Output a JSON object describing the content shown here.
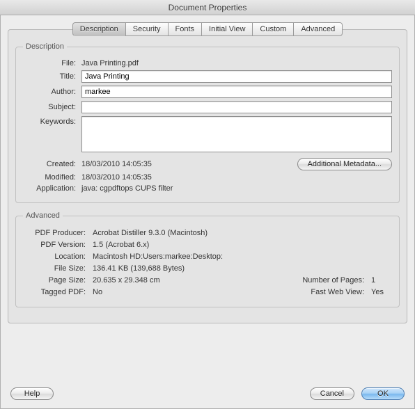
{
  "window": {
    "title": "Document Properties"
  },
  "tabs": {
    "description": "Description",
    "security": "Security",
    "fonts": "Fonts",
    "initial_view": "Initial View",
    "custom": "Custom",
    "advanced": "Advanced"
  },
  "description": {
    "legend": "Description",
    "labels": {
      "file": "File:",
      "title": "Title:",
      "author": "Author:",
      "subject": "Subject:",
      "keywords": "Keywords:",
      "created": "Created:",
      "modified": "Modified:",
      "application": "Application:"
    },
    "values": {
      "file": "Java Printing.pdf",
      "title": "Java Printing",
      "author": "markee",
      "subject": "",
      "keywords": "",
      "created": "18/03/2010 14:05:35",
      "modified": "18/03/2010 14:05:35",
      "application": "java: cgpdftops CUPS filter"
    },
    "additional_metadata_btn": "Additional Metadata..."
  },
  "advanced": {
    "legend": "Advanced",
    "labels": {
      "pdf_producer": "PDF Producer:",
      "pdf_version": "PDF Version:",
      "location": "Location:",
      "file_size": "File Size:",
      "page_size": "Page Size:",
      "number_of_pages": "Number of Pages:",
      "tagged_pdf": "Tagged PDF:",
      "fast_web_view": "Fast Web View:"
    },
    "values": {
      "pdf_producer": "Acrobat Distiller 9.3.0 (Macintosh)",
      "pdf_version": "1.5 (Acrobat 6.x)",
      "location": "Macintosh HD:Users:markee:Desktop:",
      "file_size": "136.41 KB (139,688 Bytes)",
      "page_size": "20.635 x 29.348 cm",
      "number_of_pages": "1",
      "tagged_pdf": "No",
      "fast_web_view": "Yes"
    }
  },
  "buttons": {
    "help": "Help",
    "cancel": "Cancel",
    "ok": "OK"
  }
}
